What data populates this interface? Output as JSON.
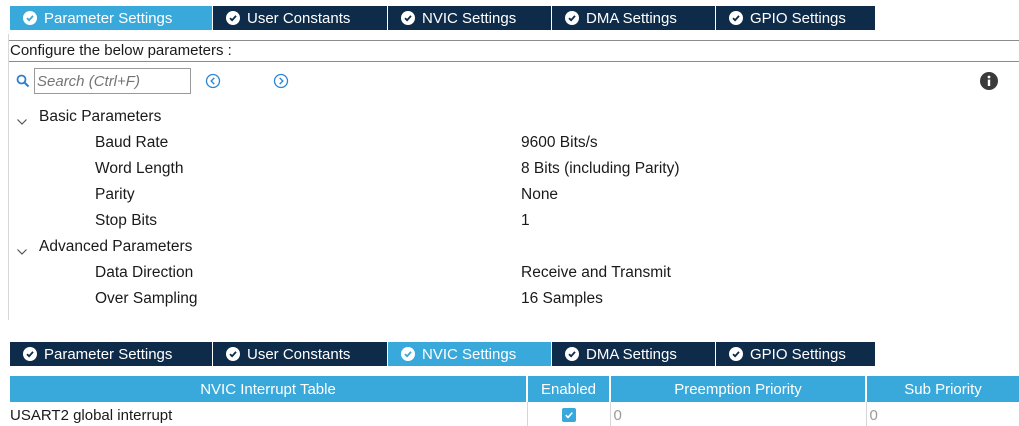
{
  "top_tabs": [
    {
      "label": "Parameter Settings",
      "active": true
    },
    {
      "label": "User Constants",
      "active": false
    },
    {
      "label": "NVIC Settings",
      "active": false
    },
    {
      "label": "DMA Settings",
      "active": false
    },
    {
      "label": "GPIO Settings",
      "active": false
    }
  ],
  "panel": {
    "configure_text": "Configure the below parameters :",
    "search_placeholder": "Search (Ctrl+F)"
  },
  "basic": {
    "title": "Basic Parameters",
    "params": [
      {
        "name": "Baud Rate",
        "value": "9600 Bits/s"
      },
      {
        "name": "Word Length",
        "value": "8 Bits (including Parity)"
      },
      {
        "name": "Parity",
        "value": "None"
      },
      {
        "name": "Stop Bits",
        "value": "1"
      }
    ]
  },
  "advanced": {
    "title": "Advanced Parameters",
    "params": [
      {
        "name": "Data Direction",
        "value": "Receive and Transmit"
      },
      {
        "name": "Over Sampling",
        "value": "16 Samples"
      }
    ]
  },
  "bottom_tabs": [
    {
      "label": "Parameter Settings",
      "active": false
    },
    {
      "label": "User Constants",
      "active": false
    },
    {
      "label": "NVIC Settings",
      "active": true
    },
    {
      "label": "DMA Settings",
      "active": false
    },
    {
      "label": "GPIO Settings",
      "active": false
    }
  ],
  "nvic_table": {
    "headers": [
      "NVIC Interrupt Table",
      "Enabled",
      "Preemption Priority",
      "Sub Priority"
    ],
    "rows": [
      {
        "name": "USART2 global interrupt",
        "enabled": true,
        "preemption": "0",
        "sub": "0"
      }
    ]
  },
  "colors": {
    "tab_dark": "#0e2c4a",
    "tab_active": "#39a9dc",
    "header_blue": "#39a9dc"
  }
}
